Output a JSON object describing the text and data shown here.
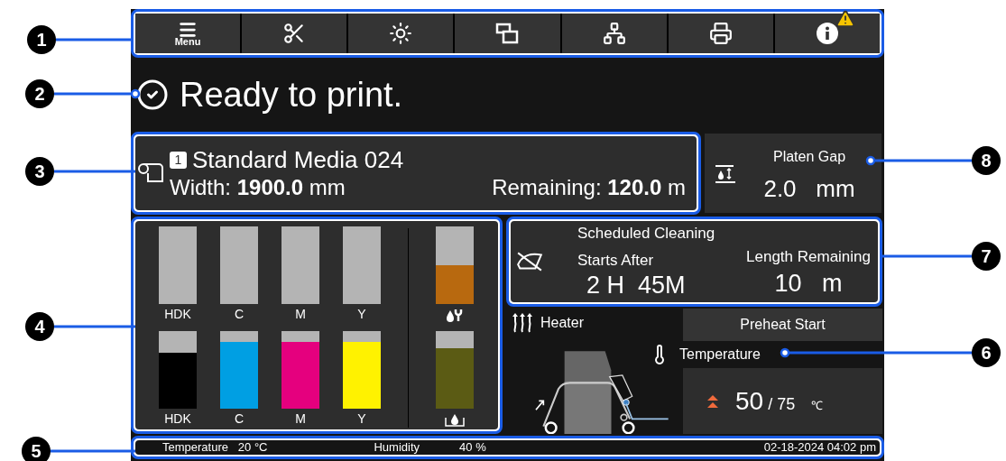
{
  "callouts_left": [
    {
      "number": "1"
    },
    {
      "number": "2"
    },
    {
      "number": "3"
    },
    {
      "number": "4"
    },
    {
      "number": "5"
    }
  ],
  "callouts_right": [
    {
      "number": "8"
    },
    {
      "number": "7"
    },
    {
      "number": "6"
    }
  ],
  "toolbar": {
    "buttons": [
      {
        "kind": "menu",
        "label": "Menu"
      },
      {
        "kind": "cut"
      },
      {
        "kind": "light"
      },
      {
        "kind": "windows"
      },
      {
        "kind": "network"
      },
      {
        "kind": "maintenance"
      },
      {
        "kind": "info",
        "warning": true
      }
    ]
  },
  "status": {
    "text": "Ready to print."
  },
  "media": {
    "number": "1",
    "name": "Standard Media 024",
    "width_label": "Width:",
    "width_value": "1900.0",
    "width_unit": "mm",
    "remaining_label": "Remaining:",
    "remaining_value": "120.0",
    "remaining_unit": "m"
  },
  "platen_gap": {
    "title": "Platen Gap",
    "value": "2.0",
    "unit": "mm"
  },
  "ink": {
    "upper": [
      {
        "label": "HDK"
      },
      {
        "label": "C"
      },
      {
        "label": "M"
      },
      {
        "label": "Y"
      }
    ],
    "lower": [
      {
        "label": "HDK",
        "level": 0.72,
        "color": "#000000"
      },
      {
        "label": "C",
        "level": 0.86,
        "color": "#009fe3"
      },
      {
        "label": "M",
        "level": 0.86,
        "color": "#e5007e"
      },
      {
        "label": "Y",
        "level": 0.86,
        "color": "#fff200"
      }
    ],
    "side": [
      {
        "kind": "maintenance",
        "level": 0.5,
        "color": "#b8690f"
      },
      {
        "kind": "waste",
        "level": 0.78,
        "color": "#5b5b14"
      }
    ]
  },
  "cleaning": {
    "title": "Scheduled Cleaning",
    "starts_label": "Starts After",
    "starts_value": "2 H  45M",
    "length_label": "Length Remaining",
    "length_value": "10",
    "length_unit": "m"
  },
  "heater": {
    "title": "Heater",
    "button": "Preheat Start",
    "temp_label": "Temperature",
    "current": "50",
    "separator": "/",
    "target": "75",
    "unit": "℃"
  },
  "status_bar": {
    "temperature_label": "Temperature",
    "temperature_value": "20 °C",
    "humidity_label": "Humidity",
    "humidity_value": "40 %",
    "datetime": "02-18-2024 04:02 pm"
  }
}
